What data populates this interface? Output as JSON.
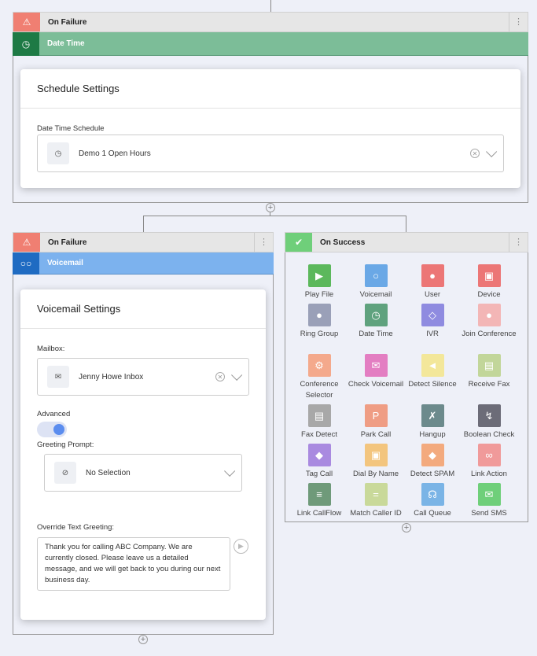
{
  "top_flow": {
    "on_failure": {
      "label": "On Failure",
      "icon": "warning-icon"
    },
    "node": {
      "label": "Date Time",
      "icon": "clock-icon",
      "color": "#7cbd98",
      "icon_bg": "#1e7a45"
    },
    "card": {
      "title": "Schedule Settings",
      "field_label": "Date Time Schedule",
      "field_value": "Demo 1 Open Hours"
    }
  },
  "voicemail_flow": {
    "on_failure": {
      "label": "On Failure",
      "icon": "warning-icon"
    },
    "node": {
      "label": "Voicemail",
      "icon": "voicemail-icon",
      "color": "#7cb2ee",
      "icon_bg": "#1f6bc2"
    },
    "card": {
      "title": "Voicemail Settings",
      "mailbox_label": "Mailbox:",
      "mailbox_value": "Jenny Howe Inbox",
      "advanced_label": "Advanced",
      "advanced_on": true,
      "greeting_label": "Greeting Prompt:",
      "greeting_value": "No Selection",
      "override_label": "Override Text Greeting:",
      "override_text": "Thank you for calling ABC Company. We are currently closed. Please leave us a detailed message, and we will get back to you during our next business day."
    }
  },
  "success_flow": {
    "on_success": {
      "label": "On Success",
      "icon": "shield-check-icon",
      "color": "#6fcf7a"
    },
    "tiles": [
      {
        "label": "Play File",
        "icon": "play-icon",
        "color": "#5cb85c"
      },
      {
        "label": "Voicemail",
        "icon": "voicemail-icon",
        "color": "#6aa8e6"
      },
      {
        "label": "User",
        "icon": "user-icon",
        "color": "#ec7676"
      },
      {
        "label": "Device",
        "icon": "device-icon",
        "color": "#ec7676"
      },
      {
        "label": "Ring Group",
        "icon": "group-icon",
        "color": "#9aa0b8"
      },
      {
        "label": "Date Time",
        "icon": "clock-icon",
        "color": "#5fa27e"
      },
      {
        "label": "IVR",
        "icon": "ivr-icon",
        "color": "#8f8be0"
      },
      {
        "label": "Join Conference",
        "icon": "conference-icon",
        "color": "#f3b6b6"
      },
      {
        "label": "Conference Selector",
        "icon": "conference-selector-icon",
        "color": "#f4a98c"
      },
      {
        "label": "Check Voicemail",
        "icon": "check-voicemail-icon",
        "color": "#e37ec2"
      },
      {
        "label": "Detect Silence",
        "icon": "speaker-icon",
        "color": "#f3e79a"
      },
      {
        "label": "Receive Fax",
        "icon": "fax-icon",
        "color": "#c2d69a"
      },
      {
        "label": "Fax Detect",
        "icon": "printer-icon",
        "color": "#a8a8a8"
      },
      {
        "label": "Park Call",
        "icon": "parking-icon",
        "color": "#ef9d84"
      },
      {
        "label": "Hangup",
        "icon": "hangup-icon",
        "color": "#6c8a8c"
      },
      {
        "label": "Boolean Check",
        "icon": "branch-icon",
        "color": "#6c6c78"
      },
      {
        "label": "Tag Call",
        "icon": "tag-icon",
        "color": "#a98ae0"
      },
      {
        "label": "Dial By Name",
        "icon": "dial-icon",
        "color": "#f3c57e"
      },
      {
        "label": "Detect SPAM",
        "icon": "shield-icon",
        "color": "#f3aa7e"
      },
      {
        "label": "Link Action",
        "icon": "link-icon",
        "color": "#f09a9a"
      },
      {
        "label": "Link CallFlow",
        "icon": "list-icon",
        "color": "#6f9a7a"
      },
      {
        "label": "Match Caller ID",
        "icon": "equals-icon",
        "color": "#c9d99a"
      },
      {
        "label": "Call Queue",
        "icon": "headset-icon",
        "color": "#7ab4e6"
      },
      {
        "label": "Send SMS",
        "icon": "sms-icon",
        "color": "#6fcf7a"
      }
    ]
  }
}
